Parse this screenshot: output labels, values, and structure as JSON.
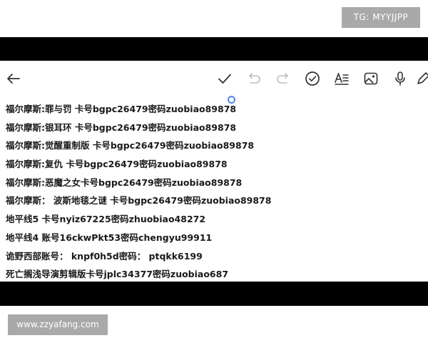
{
  "watermarks": {
    "top": "TG: MYYJJPP",
    "bottom": "www.zzyafang.com"
  },
  "toolbar": {
    "icons": [
      "back-arrow-icon",
      "checkmark-icon",
      "undo-icon",
      "redo-icon",
      "checklist-circle-icon",
      "text-format-icon",
      "image-icon",
      "microphone-icon",
      "pen-icon"
    ]
  },
  "note": {
    "lines": [
      "福尔摩斯:罪与罚 卡号bgpc26479密码zuobiao89878",
      "福尔摩斯:银耳环 卡号bgpc26479密码zuobiao89878",
      "福尔摩斯:觉醒重制版 卡号bgpc26479密码zuobiao89878",
      "福尔摩斯:复仇 卡号bgpc26479密码zuobiao89878",
      "福尔摩斯:恶魔之女卡号bgpc26479密码zuobiao89878",
      "福尔摩斯： 波斯地毯之谜 卡号bgpc26479密码zuobiao89878",
      "地平线5 卡号nyiz67225密码zhuobiao48272",
      "地平线4 账号16ckwPkt53密码chengyu99911",
      "诡野西部账号： knpf0h5d密码： ptqkk6199",
      "死亡搁浅导演剪辑版卡号jplc34377密码zuobiao687"
    ]
  },
  "colors": {
    "bars": "#000000",
    "watermark_bg": "#a9a9a9",
    "cursor": "#4f86e6",
    "text": "#1a1a1a"
  }
}
